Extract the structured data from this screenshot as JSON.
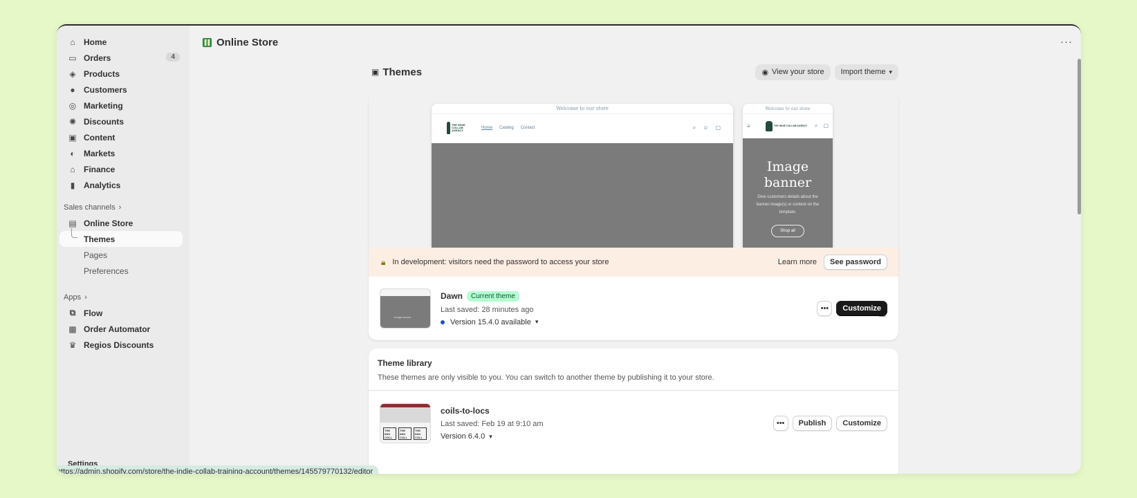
{
  "sidebar": {
    "items": [
      {
        "label": "Home",
        "icon": "home-icon"
      },
      {
        "label": "Orders",
        "icon": "inbox-icon",
        "count": "4"
      },
      {
        "label": "Products",
        "icon": "tag-icon"
      },
      {
        "label": "Customers",
        "icon": "person-icon"
      },
      {
        "label": "Marketing",
        "icon": "target-icon"
      },
      {
        "label": "Discounts",
        "icon": "discount-icon"
      },
      {
        "label": "Content",
        "icon": "content-icon"
      },
      {
        "label": "Markets",
        "icon": "globe-icon"
      },
      {
        "label": "Finance",
        "icon": "bank-icon"
      },
      {
        "label": "Analytics",
        "icon": "bar-chart-icon"
      }
    ],
    "sales_channels_label": "Sales channels",
    "online_store_label": "Online Store",
    "sub_items": [
      "Themes",
      "Pages",
      "Preferences"
    ],
    "apps_label": "Apps",
    "apps": [
      "Flow",
      "Order Automator",
      "Regios Discounts"
    ],
    "settings_label": "Settings"
  },
  "topbar": {
    "title": "Online Store",
    "more": "···"
  },
  "page": {
    "title": "Themes",
    "view_store": "View your store",
    "import_theme": "Import theme"
  },
  "preview": {
    "announcement": "Welcome to our store",
    "nav": [
      "Home",
      "Catalog",
      "Contact"
    ],
    "logo_text": "THE INDIE COLLAB AGENCY",
    "mobile_heading": "Image banner",
    "mobile_text": "Give customers details about the banner image(s) or content on the template.",
    "mobile_button": "Shop all"
  },
  "dev_banner": {
    "text": "In development: visitors need the password to access your store",
    "learn_more": "Learn more",
    "see_password": "See password"
  },
  "current_theme": {
    "name": "Dawn",
    "badge": "Current theme",
    "last_saved": "Last saved: 28 minutes ago",
    "version": "Version 15.4.0 available",
    "customize": "Customize"
  },
  "library": {
    "title": "Theme library",
    "description": "These themes are only visible to you. You can switch to another theme by publishing it to your store.",
    "themes": [
      {
        "name": "coils-to-locs",
        "last_saved": "Last saved: Feb 19 at 9:10 am",
        "version": "Version 6.4.0",
        "publish": "Publish",
        "customize": "Customize"
      }
    ]
  },
  "status_url": "https://admin.shopify.com/store/the-indie-collab-training-account/themes/145579770132/editor"
}
